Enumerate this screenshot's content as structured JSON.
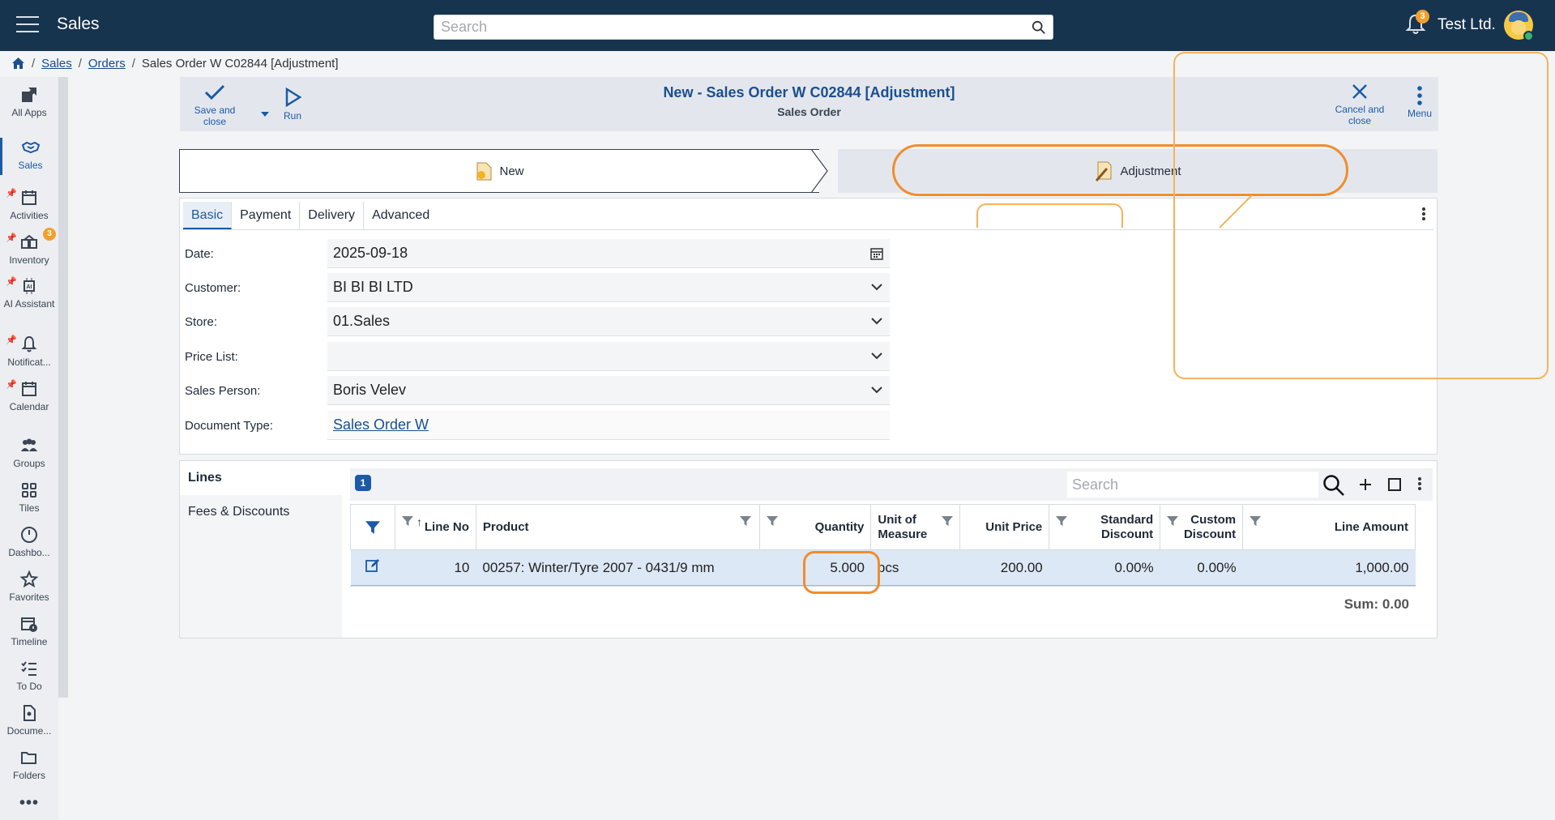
{
  "topbar": {
    "app_title": "Sales",
    "search_placeholder": "Search",
    "notification_count": "3",
    "company": "Test Ltd."
  },
  "breadcrumb": {
    "items": [
      "Sales",
      "Orders"
    ],
    "current": "Sales Order W C02844 [Adjustment]"
  },
  "sidebar": {
    "items": [
      {
        "label": "All Apps"
      },
      {
        "label": "Sales"
      },
      {
        "label": "Activities"
      },
      {
        "label": "Inventory",
        "badge": "3"
      },
      {
        "label": "AI Assistant"
      },
      {
        "label": "Notificat..."
      },
      {
        "label": "Calendar"
      },
      {
        "label": "Groups"
      },
      {
        "label": "Tiles"
      },
      {
        "label": "Dashbo..."
      },
      {
        "label": "Favorites"
      },
      {
        "label": "Timeline"
      },
      {
        "label": "To Do"
      },
      {
        "label": "Docume..."
      },
      {
        "label": "Folders"
      }
    ]
  },
  "toolbar": {
    "save_close": "Save and close",
    "run": "Run",
    "title": "New - Sales Order W C02844 [Adjustment]",
    "subtitle": "Sales Order",
    "cancel_close": "Cancel and close",
    "menu": "Menu"
  },
  "stages": {
    "new": "New",
    "adjustment": "Adjustment"
  },
  "tabs": [
    "Basic",
    "Payment",
    "Delivery",
    "Advanced"
  ],
  "form": {
    "date": {
      "label": "Date:",
      "value": "2025-09-18"
    },
    "customer": {
      "label": "Customer:",
      "value": "BI BI BI LTD"
    },
    "store": {
      "label": "Store:",
      "value": "01.Sales"
    },
    "price_list": {
      "label": "Price List:",
      "value": ""
    },
    "sales_person": {
      "label": "Sales Person:",
      "value": "Boris Velev"
    },
    "document_type": {
      "label": "Document Type:",
      "value": "Sales Order W"
    }
  },
  "lines_nav": [
    "Lines",
    "Fees & Discounts"
  ],
  "grid": {
    "count": "1",
    "search_placeholder": "Search",
    "columns": [
      "Line No",
      "Product",
      "Quantity",
      "Unit of Measure",
      "Unit Price",
      "Standard Discount",
      "Custom Discount",
      "Line Amount"
    ],
    "rows": [
      {
        "line_no": "10",
        "product": "00257: Winter/Tyre 2007 - 0431/9 mm",
        "quantity": "5.000",
        "uom": "pcs",
        "unit_price": "200.00",
        "std_discount": "0.00%",
        "custom_discount": "0.00%",
        "line_amount": "1,000.00"
      }
    ],
    "sum": "Sum: 0.00"
  },
  "colors": {
    "topbar": "#17344f",
    "accent": "#1b5aa6",
    "highlight": "#f18d2c"
  }
}
